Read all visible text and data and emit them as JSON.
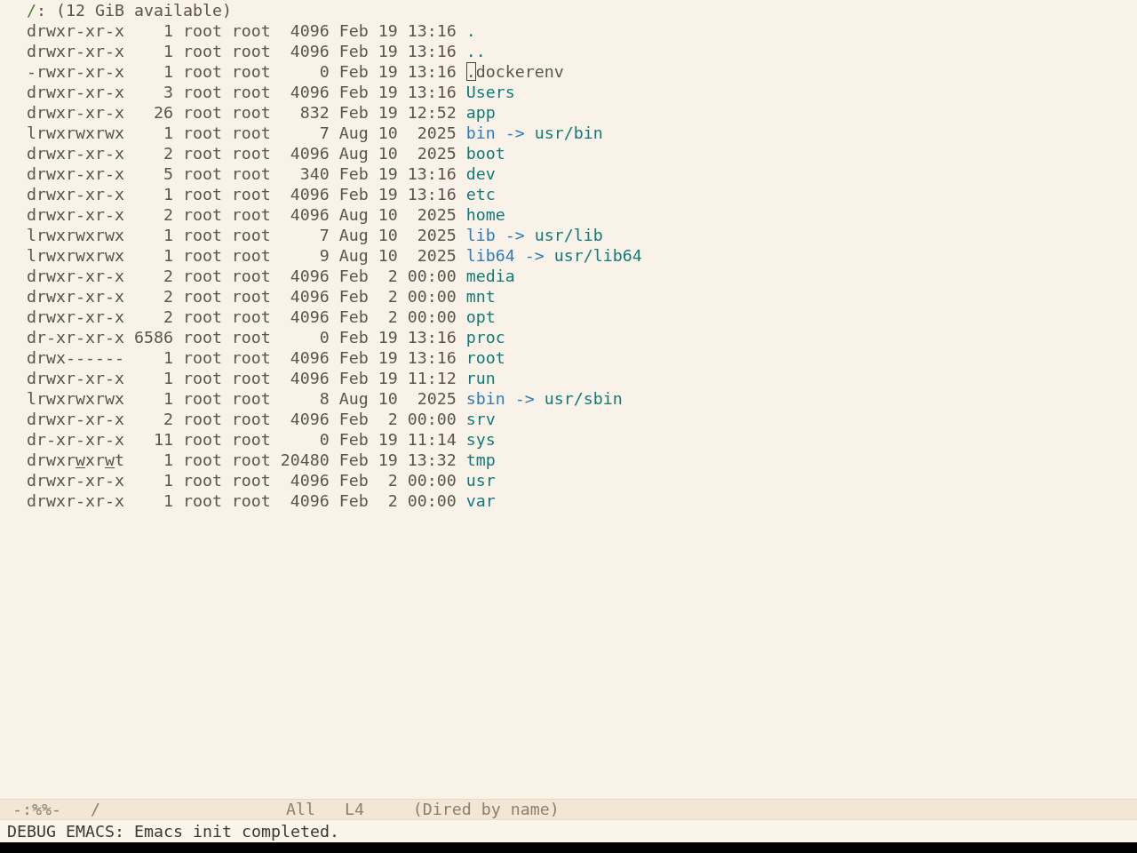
{
  "header": {
    "path": "/",
    "info": ": (12 GiB available)"
  },
  "rows": [
    {
      "permissions": "drwxr-xr-x",
      "write_highlight": false,
      "links": "1",
      "owner": "root",
      "group": "root",
      "size": "4096",
      "date": "Feb 19 13:16",
      "kind": "directory",
      "name": ".",
      "cursor": false
    },
    {
      "permissions": "drwxr-xr-x",
      "write_highlight": false,
      "links": "1",
      "owner": "root",
      "group": "root",
      "size": "4096",
      "date": "Feb 19 13:16",
      "kind": "directory",
      "name": "..",
      "cursor": false
    },
    {
      "permissions": "-rwxr-xr-x",
      "write_highlight": false,
      "links": "1",
      "owner": "root",
      "group": "root",
      "size": "0",
      "date": "Feb 19 13:16",
      "kind": "file",
      "name": ".dockerenv",
      "cursor": true
    },
    {
      "permissions": "drwxr-xr-x",
      "write_highlight": false,
      "links": "3",
      "owner": "root",
      "group": "root",
      "size": "4096",
      "date": "Feb 19 13:16",
      "kind": "directory",
      "name": "Users",
      "cursor": false
    },
    {
      "permissions": "drwxr-xr-x",
      "write_highlight": false,
      "links": "26",
      "owner": "root",
      "group": "root",
      "size": "832",
      "date": "Feb 19 12:52",
      "kind": "directory",
      "name": "app",
      "cursor": false
    },
    {
      "permissions": "lrwxrwxrwx",
      "write_highlight": false,
      "links": "1",
      "owner": "root",
      "group": "root",
      "size": "7",
      "date": "Aug 10  2025",
      "kind": "symlink",
      "name": "bin",
      "arrow": "->",
      "target": "usr/bin",
      "cursor": false
    },
    {
      "permissions": "drwxr-xr-x",
      "write_highlight": false,
      "links": "2",
      "owner": "root",
      "group": "root",
      "size": "4096",
      "date": "Aug 10  2025",
      "kind": "directory",
      "name": "boot",
      "cursor": false
    },
    {
      "permissions": "drwxr-xr-x",
      "write_highlight": false,
      "links": "5",
      "owner": "root",
      "group": "root",
      "size": "340",
      "date": "Feb 19 13:16",
      "kind": "directory",
      "name": "dev",
      "cursor": false
    },
    {
      "permissions": "drwxr-xr-x",
      "write_highlight": false,
      "links": "1",
      "owner": "root",
      "group": "root",
      "size": "4096",
      "date": "Feb 19 13:16",
      "kind": "directory",
      "name": "etc",
      "cursor": false
    },
    {
      "permissions": "drwxr-xr-x",
      "write_highlight": false,
      "links": "2",
      "owner": "root",
      "group": "root",
      "size": "4096",
      "date": "Aug 10  2025",
      "kind": "directory",
      "name": "home",
      "cursor": false
    },
    {
      "permissions": "lrwxrwxrwx",
      "write_highlight": false,
      "links": "1",
      "owner": "root",
      "group": "root",
      "size": "7",
      "date": "Aug 10  2025",
      "kind": "symlink",
      "name": "lib",
      "arrow": "->",
      "target": "usr/lib",
      "cursor": false
    },
    {
      "permissions": "lrwxrwxrwx",
      "write_highlight": false,
      "links": "1",
      "owner": "root",
      "group": "root",
      "size": "9",
      "date": "Aug 10  2025",
      "kind": "symlink",
      "name": "lib64",
      "arrow": "->",
      "target": "usr/lib64",
      "cursor": false
    },
    {
      "permissions": "drwxr-xr-x",
      "write_highlight": false,
      "links": "2",
      "owner": "root",
      "group": "root",
      "size": "4096",
      "date": "Feb  2 00:00",
      "kind": "directory",
      "name": "media",
      "cursor": false
    },
    {
      "permissions": "drwxr-xr-x",
      "write_highlight": false,
      "links": "2",
      "owner": "root",
      "group": "root",
      "size": "4096",
      "date": "Feb  2 00:00",
      "kind": "directory",
      "name": "mnt",
      "cursor": false
    },
    {
      "permissions": "drwxr-xr-x",
      "write_highlight": false,
      "links": "2",
      "owner": "root",
      "group": "root",
      "size": "4096",
      "date": "Feb  2 00:00",
      "kind": "directory",
      "name": "opt",
      "cursor": false
    },
    {
      "permissions": "dr-xr-xr-x",
      "write_highlight": false,
      "links": "6586",
      "owner": "root",
      "group": "root",
      "size": "0",
      "date": "Feb 19 13:16",
      "kind": "directory",
      "name": "proc",
      "cursor": false
    },
    {
      "permissions": "drwx------",
      "write_highlight": false,
      "links": "1",
      "owner": "root",
      "group": "root",
      "size": "4096",
      "date": "Feb 19 13:16",
      "kind": "directory",
      "name": "root",
      "cursor": false
    },
    {
      "permissions": "drwxr-xr-x",
      "write_highlight": false,
      "links": "1",
      "owner": "root",
      "group": "root",
      "size": "4096",
      "date": "Feb 19 11:12",
      "kind": "directory",
      "name": "run",
      "cursor": false
    },
    {
      "permissions": "lrwxrwxrwx",
      "write_highlight": false,
      "links": "1",
      "owner": "root",
      "group": "root",
      "size": "8",
      "date": "Aug 10  2025",
      "kind": "symlink",
      "name": "sbin",
      "arrow": "->",
      "target": "usr/sbin",
      "cursor": false
    },
    {
      "permissions": "drwxr-xr-x",
      "write_highlight": false,
      "links": "2",
      "owner": "root",
      "group": "root",
      "size": "4096",
      "date": "Feb  2 00:00",
      "kind": "directory",
      "name": "srv",
      "cursor": false
    },
    {
      "permissions": "dr-xr-xr-x",
      "write_highlight": false,
      "links": "11",
      "owner": "root",
      "group": "root",
      "size": "0",
      "date": "Feb 19 11:14",
      "kind": "directory",
      "name": "sys",
      "cursor": false
    },
    {
      "permissions": "drwxrwxrwt",
      "write_highlight": true,
      "links": "1",
      "owner": "root",
      "group": "root",
      "size": "20480",
      "date": "Feb 19 13:32",
      "kind": "directory",
      "name": "tmp",
      "cursor": false
    },
    {
      "permissions": "drwxr-xr-x",
      "write_highlight": false,
      "links": "1",
      "owner": "root",
      "group": "root",
      "size": "4096",
      "date": "Feb  2 00:00",
      "kind": "directory",
      "name": "usr",
      "cursor": false
    },
    {
      "permissions": "drwxr-xr-x",
      "write_highlight": false,
      "links": "1",
      "owner": "root",
      "group": "root",
      "size": "4096",
      "date": "Feb  2 00:00",
      "kind": "directory",
      "name": "var",
      "cursor": false
    }
  ],
  "mode_line": {
    "status": "-:%%-",
    "buffer_name": "/",
    "position": "All",
    "line": "L4",
    "mode": "(Dired by name)"
  },
  "echo_area": {
    "message": "DEBUG EMACS: Emacs init completed."
  }
}
